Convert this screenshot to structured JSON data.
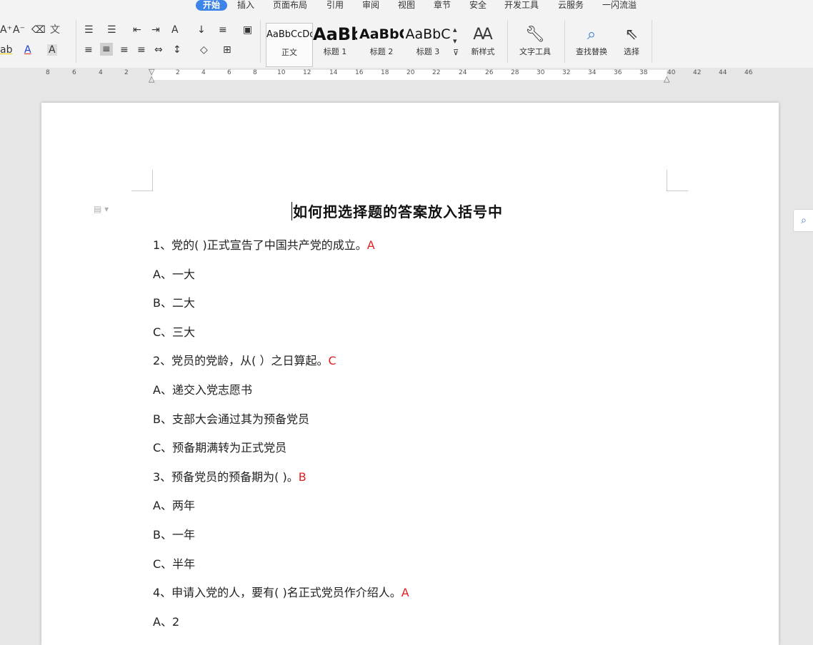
{
  "menu": {
    "tabs": [
      "开始",
      "插入",
      "页面布局",
      "引用",
      "审阅",
      "视图",
      "章节",
      "安全",
      "开发工具",
      "云服务",
      "一闪流溢"
    ],
    "active": "开始"
  },
  "ribbon": {
    "styles": [
      {
        "sample": "AaBbCcDd",
        "label": "正文"
      },
      {
        "sample": "AaBb",
        "label": "标题 1"
      },
      {
        "sample": "AaBbC",
        "label": "标题 2"
      },
      {
        "sample": "AaBbC",
        "label": "标题 3"
      }
    ],
    "new_style": "新样式",
    "text_tools": "文字工具",
    "find_replace": "查找替换",
    "select": "选择"
  },
  "ruler": {
    "ticks": [
      "8",
      "6",
      "4",
      "2",
      "2",
      "4",
      "6",
      "8",
      "10",
      "12",
      "14",
      "16",
      "18",
      "20",
      "22",
      "24",
      "26",
      "28",
      "30",
      "32",
      "34",
      "36",
      "38",
      "40",
      "42",
      "44",
      "46"
    ]
  },
  "document": {
    "title": "如何把选择题的答案放入括号中",
    "lines": [
      {
        "text": "1、党的(          )正式宣告了中国共产党的成立。",
        "answer": "A"
      },
      {
        "text": "A、一大",
        "answer": ""
      },
      {
        "text": "B、二大",
        "answer": ""
      },
      {
        "text": "C、三大",
        "answer": ""
      },
      {
        "text": "2、党员的党龄，从(           ）之日算起。",
        "answer": "C"
      },
      {
        "text": "A、递交入党志愿书",
        "answer": ""
      },
      {
        "text": "B、支部大会通过其为预备党员",
        "answer": ""
      },
      {
        "text": "C、预备期满转为正式党员",
        "answer": ""
      },
      {
        "text": "3、预备党员的预备期为(        )。",
        "answer": "B"
      },
      {
        "text": "A、两年",
        "answer": ""
      },
      {
        "text": "B、一年",
        "answer": ""
      },
      {
        "text": "C、半年",
        "answer": ""
      },
      {
        "text": "4、申请入党的人，要有(    )名正式党员作介绍人。",
        "answer": "A"
      },
      {
        "text": "A、2",
        "answer": ""
      }
    ]
  },
  "colors": {
    "accent": "#3c84e8",
    "answer": "#e02020"
  }
}
